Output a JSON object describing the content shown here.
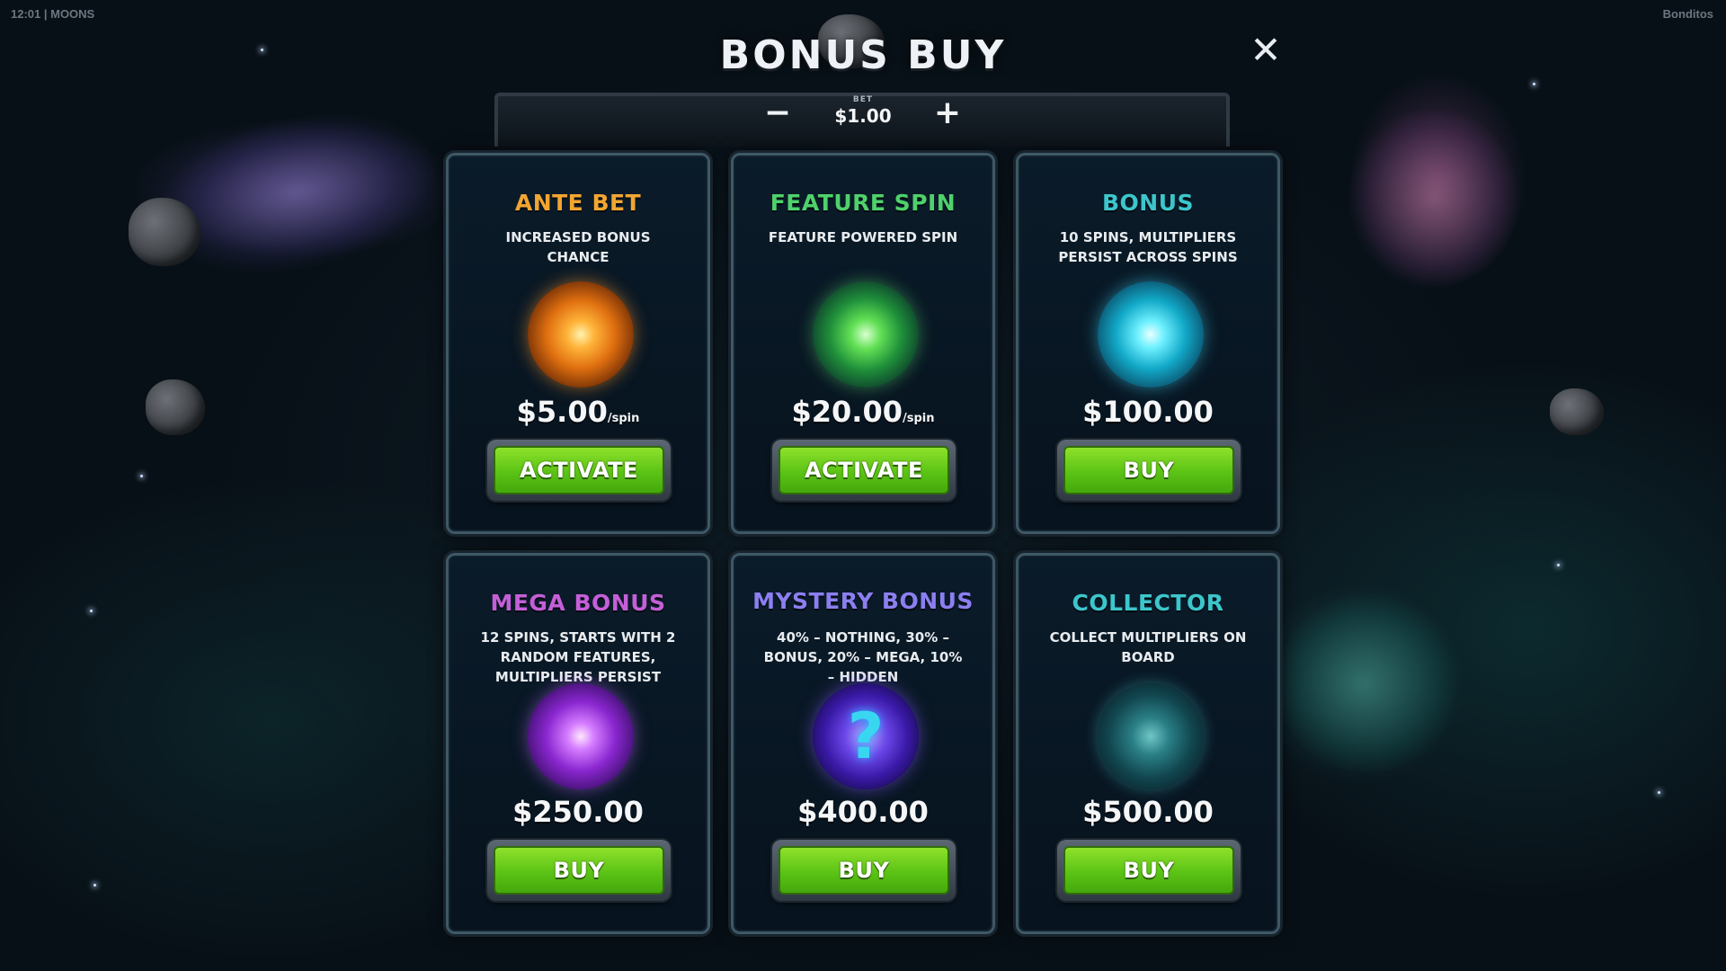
{
  "status": {
    "left_info": "12:01 | MOONS",
    "brand": "Bonditos"
  },
  "header": {
    "title": "BONUS BUY",
    "close_icon": "close-icon"
  },
  "bet": {
    "label": "BET",
    "value": "$1.00",
    "minus": "−",
    "plus": "+"
  },
  "cards": [
    {
      "title": "ANTE BET",
      "title_color": "#f2a531",
      "description": "INCREASED BONUS CHANCE",
      "orb": "orange-vortex-orb-icon",
      "price": "$5.00",
      "unit": "/spin",
      "button": "ACTIVATE"
    },
    {
      "title": "FEATURE SPIN",
      "title_color": "#4fd16b",
      "description": "FEATURE POWERED SPIN",
      "orb": "green-energy-orb-icon",
      "price": "$20.00",
      "unit": "/spin",
      "button": "ACTIVATE"
    },
    {
      "title": "BONUS",
      "title_color": "#3cc6cc",
      "description": "10 SPINS, MULTIPLIERS PERSIST ACROSS SPINS",
      "orb": "cyan-vortex-orb-icon",
      "price": "$100.00",
      "unit": "",
      "button": "BUY"
    },
    {
      "title": "MEGA BONUS",
      "title_color": "#c55fd8",
      "description": "12 SPINS, STARTS WITH 2 RANDOM FEATURES, MULTIPLIERS PERSIST",
      "orb": "purple-vortex-orb-icon",
      "price": "$250.00",
      "unit": "",
      "button": "BUY"
    },
    {
      "title": "MYSTERY BONUS",
      "title_color": "#8b7ff0",
      "description": "40% – NOTHING, 30% – BONUS, 20% – MEGA, 10% – HIDDEN",
      "orb": "question-mark-orb-icon",
      "glyph": "?",
      "price": "$400.00",
      "unit": "",
      "button": "BUY"
    },
    {
      "title": "COLLECTOR",
      "title_color": "#3cc6cc",
      "description": "COLLECT MULTIPLIERS ON BOARD",
      "orb": "octopus-orb-icon",
      "price": "$500.00",
      "unit": "",
      "button": "BUY"
    }
  ]
}
